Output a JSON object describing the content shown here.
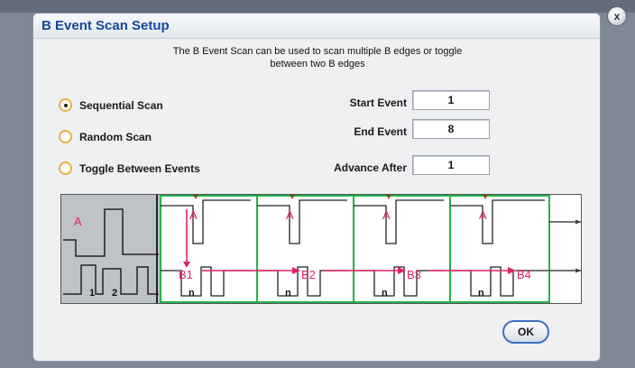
{
  "window": {
    "close_label": "x"
  },
  "dialog": {
    "title": "B Event Scan Setup",
    "description_line1": "The B Event Scan can be used to scan multiple B edges or toggle",
    "description_line2": "between two B edges"
  },
  "scan_modes": [
    {
      "label": "Sequential Scan",
      "selected": true
    },
    {
      "label": "Random Scan",
      "selected": false
    },
    {
      "label": "Toggle Between Events",
      "selected": false
    }
  ],
  "fields": {
    "start_event": {
      "label": "Start Event",
      "value": "1"
    },
    "end_event": {
      "label": "End Event",
      "value": "8"
    },
    "advance_after": {
      "label": "Advance After",
      "value": "1"
    }
  },
  "diagram": {
    "overview_a_label": "A",
    "overview_pulse_labels": [
      "1",
      "2"
    ],
    "panel_a_label": "A",
    "panel_n_label": "n",
    "b_labels": [
      "B1",
      "B2",
      "B3",
      "B4"
    ],
    "colors": {
      "trigger": "#e0245e",
      "panel_border": "#24b24a",
      "marker": "#8b4513"
    }
  },
  "buttons": {
    "ok_label": "OK"
  }
}
